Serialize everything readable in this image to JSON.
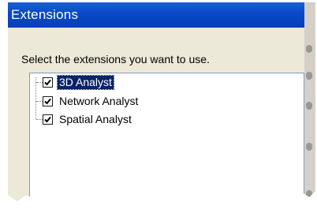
{
  "dialog": {
    "title": "Extensions",
    "prompt": "Select the extensions you want to use."
  },
  "extensions": [
    {
      "label": "3D Analyst",
      "checked": true,
      "selected": true
    },
    {
      "label": "Network Analyst",
      "checked": true,
      "selected": false
    },
    {
      "label": "Spatial Analyst",
      "checked": true,
      "selected": false
    }
  ],
  "colors": {
    "title_bar": "#0a4ac9",
    "dialog_bg": "#ece9d8",
    "selection": "#0a246a"
  }
}
